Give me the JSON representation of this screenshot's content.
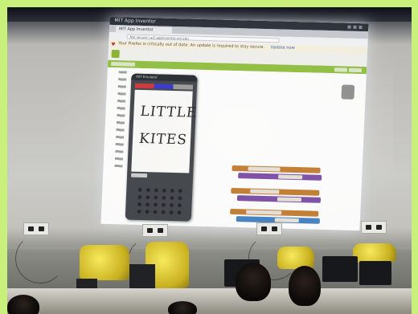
{
  "browser": {
    "window_title": "MIT App Inventor",
    "tab_label": "MIT App Inventor",
    "url": "Not secure | ai2.appinventor.mit.edu",
    "warning_text": "Your Firefox is critically out of date. An update is required to stay secure.",
    "warning_link": "Update now"
  },
  "emulator": {
    "title": "MIT Emulator",
    "handwriting_line1": "LITTLE",
    "handwriting_line2": "KITES"
  },
  "colors": {
    "border_accent": "#c8f07a",
    "app_green": "#8fbf3c",
    "cover_yellow": "#f1dc3e"
  }
}
